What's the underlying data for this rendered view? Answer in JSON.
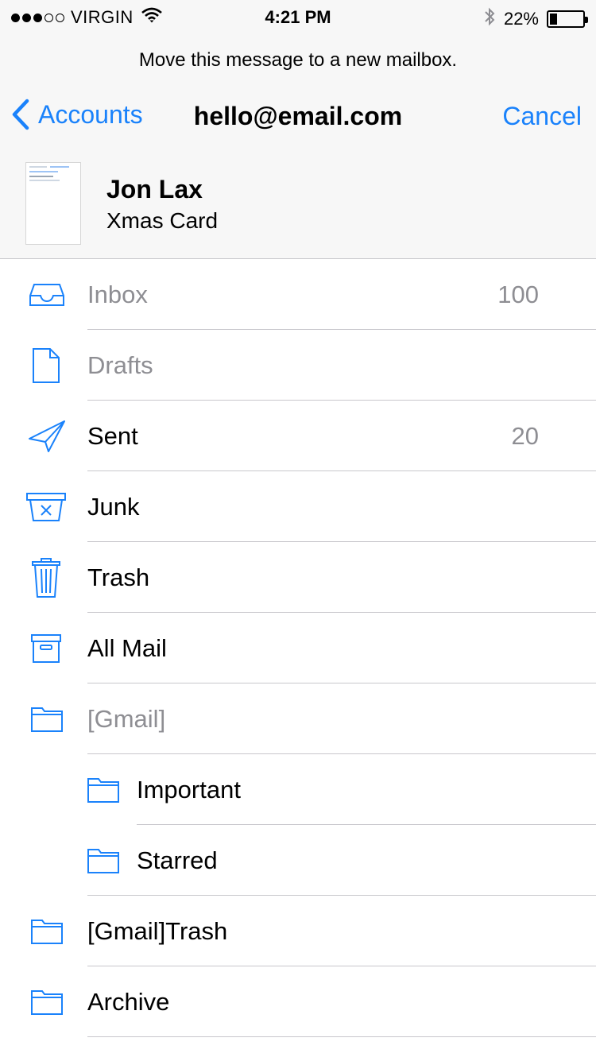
{
  "status_bar": {
    "carrier": "VIRGIN",
    "time": "4:21 PM",
    "battery_pct": "22%",
    "icons": [
      "signal-dots",
      "wifi-icon",
      "bluetooth-icon",
      "battery-icon"
    ]
  },
  "prompt": "Move this message to a new mailbox.",
  "nav": {
    "back_label": "Accounts",
    "title": "hello@email.com",
    "cancel_label": "Cancel"
  },
  "message": {
    "sender": "Jon Lax",
    "subject": "Xmas Card"
  },
  "mailboxes": [
    {
      "label": "Inbox",
      "count": "100",
      "icon": "inbox-tray-icon",
      "dim": true
    },
    {
      "label": "Drafts",
      "count": "",
      "icon": "draft-document-icon",
      "dim": true
    },
    {
      "label": "Sent",
      "count": "20",
      "icon": "paper-plane-icon",
      "dim": false
    },
    {
      "label": "Junk",
      "count": "",
      "icon": "junk-bin-icon",
      "dim": false
    },
    {
      "label": "Trash",
      "count": "",
      "icon": "trash-can-icon",
      "dim": false
    },
    {
      "label": "All Mail",
      "count": "",
      "icon": "archive-box-icon",
      "dim": false
    },
    {
      "label": "[Gmail]",
      "count": "",
      "icon": "folder-icon",
      "dim": true
    },
    {
      "label": "Important",
      "count": "",
      "icon": "folder-icon",
      "dim": false
    },
    {
      "label": "Starred",
      "count": "",
      "icon": "folder-icon",
      "dim": false
    },
    {
      "label": "[Gmail]Trash",
      "count": "",
      "icon": "folder-icon",
      "dim": false
    },
    {
      "label": "Archive",
      "count": "",
      "icon": "folder-icon",
      "dim": false
    }
  ],
  "colors": {
    "accent": "#1a82fb",
    "dim_text": "#8e8e93",
    "header_bg": "#f7f7f7",
    "separator": "#c8c7cc"
  }
}
